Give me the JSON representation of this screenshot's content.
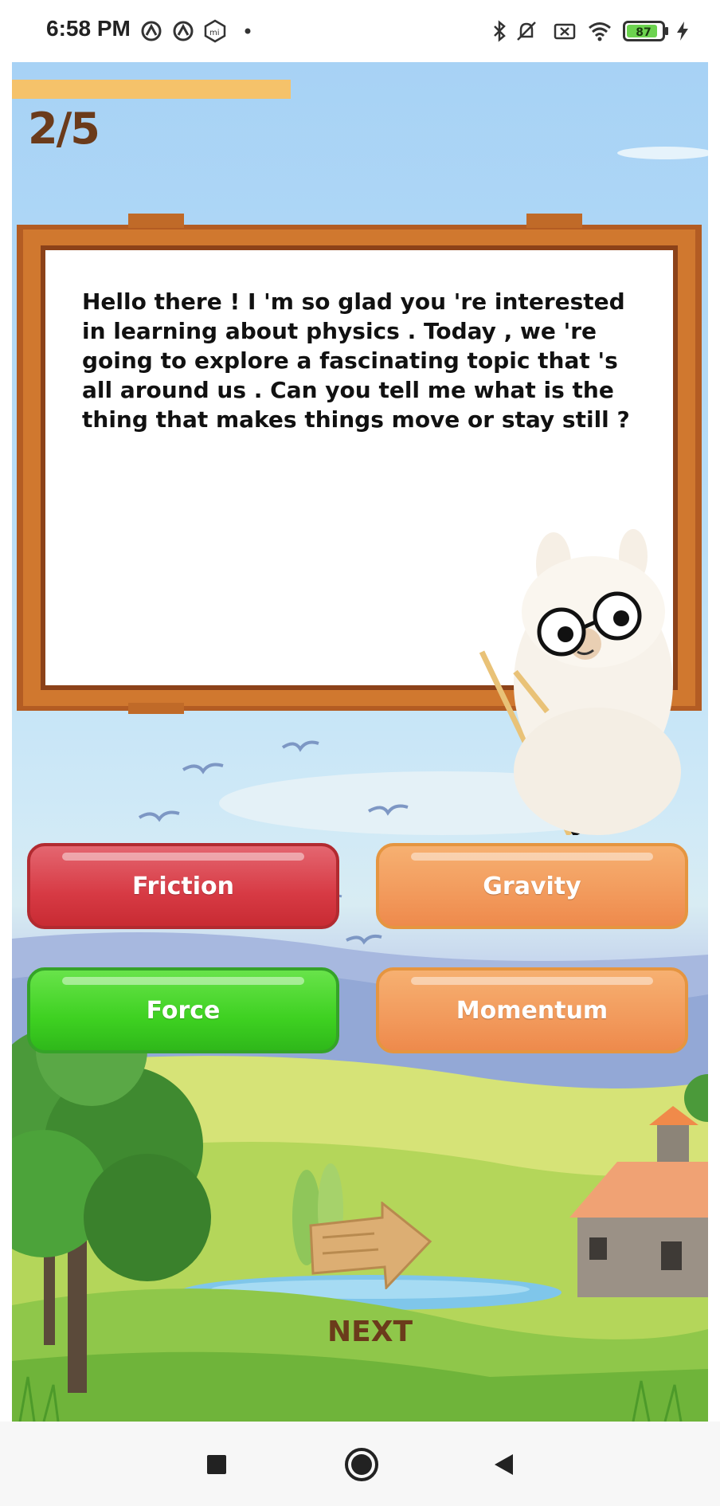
{
  "status_bar": {
    "time": "6:58 PM",
    "battery": "87",
    "icons": [
      "notification-icon",
      "notification-icon",
      "mi-icon",
      "dot-icon",
      "bluetooth-icon",
      "mute-icon",
      "sim-icon",
      "wifi-icon",
      "battery-icon",
      "charging-icon"
    ]
  },
  "quiz": {
    "counter": "2/5",
    "progress": 0.4,
    "question": "Hello there ! I 'm so glad you 're interested in learning about physics . Today , we 're going to explore a fascinating topic that 's all around us . Can you tell me what is the thing that makes things move or stay still ?",
    "answers": [
      {
        "label": "Friction",
        "state": "wrong",
        "color": "#d73a44"
      },
      {
        "label": "Gravity",
        "state": "neutral",
        "color": "#f29a5c"
      },
      {
        "label": "Force",
        "state": "correct",
        "color": "#3ed121"
      },
      {
        "label": "Momentum",
        "state": "neutral",
        "color": "#f29a5c"
      }
    ],
    "next_label": "NEXT"
  },
  "colors": {
    "progress": "#f5c26a",
    "title_brown": "#6b3b1b",
    "board_frame": "#c86a2c"
  },
  "nav": {
    "recents": "recents-icon",
    "home": "home-icon",
    "back": "back-icon"
  }
}
